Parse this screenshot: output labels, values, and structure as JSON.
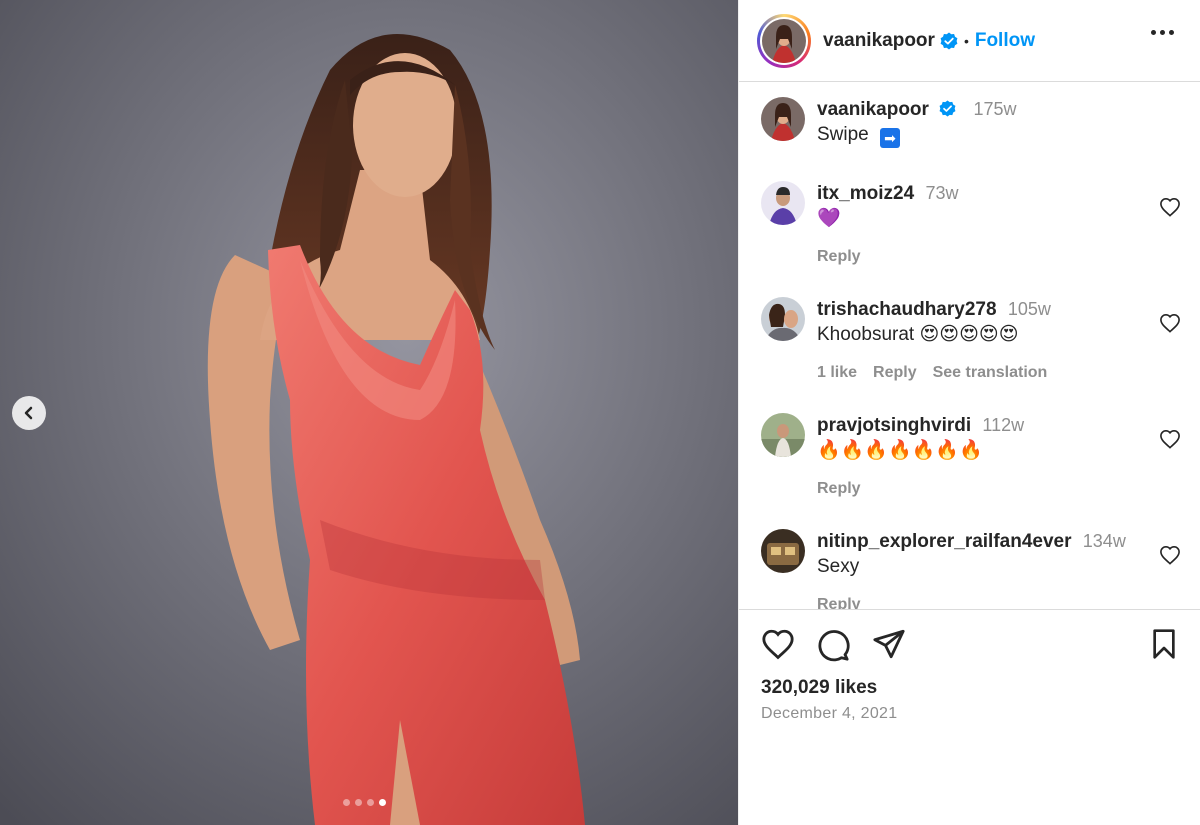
{
  "header": {
    "username": "vaanikapoor",
    "separator": "•",
    "follow_label": "Follow"
  },
  "caption": {
    "username": "vaanikapoor",
    "time": "175w",
    "text": "Swipe",
    "emoji": "➡"
  },
  "comments": [
    {
      "username": "itx_moiz24",
      "time": "73w",
      "text": "💜",
      "meta": [
        "Reply"
      ]
    },
    {
      "username": "trishachaudhary278",
      "time": "105w",
      "text": "Khoobsurat 😍😍😍😍😍",
      "meta": [
        "1 like",
        "Reply",
        "See translation"
      ]
    },
    {
      "username": "pravjotsinghvirdi",
      "time": "112w",
      "text": "🔥🔥🔥🔥🔥🔥🔥",
      "meta": [
        "Reply"
      ]
    },
    {
      "username": "nitinp_explorer_railfan4ever",
      "time": "134w",
      "text": "Sexy",
      "meta": [
        "Reply"
      ]
    }
  ],
  "stats": {
    "likes": "320,029 likes",
    "date": "December 4, 2021"
  },
  "carousel": {
    "count": 4,
    "active_index": 3
  },
  "colors": {
    "accent": "#0095f6",
    "verified": "#0095f6",
    "muted": "#8e8e8e",
    "dress": "#e2554f"
  },
  "icons": [
    "chevron-left-icon",
    "more-icon",
    "verified-icon",
    "heart-icon",
    "comment-icon",
    "share-icon",
    "bookmark-icon"
  ]
}
